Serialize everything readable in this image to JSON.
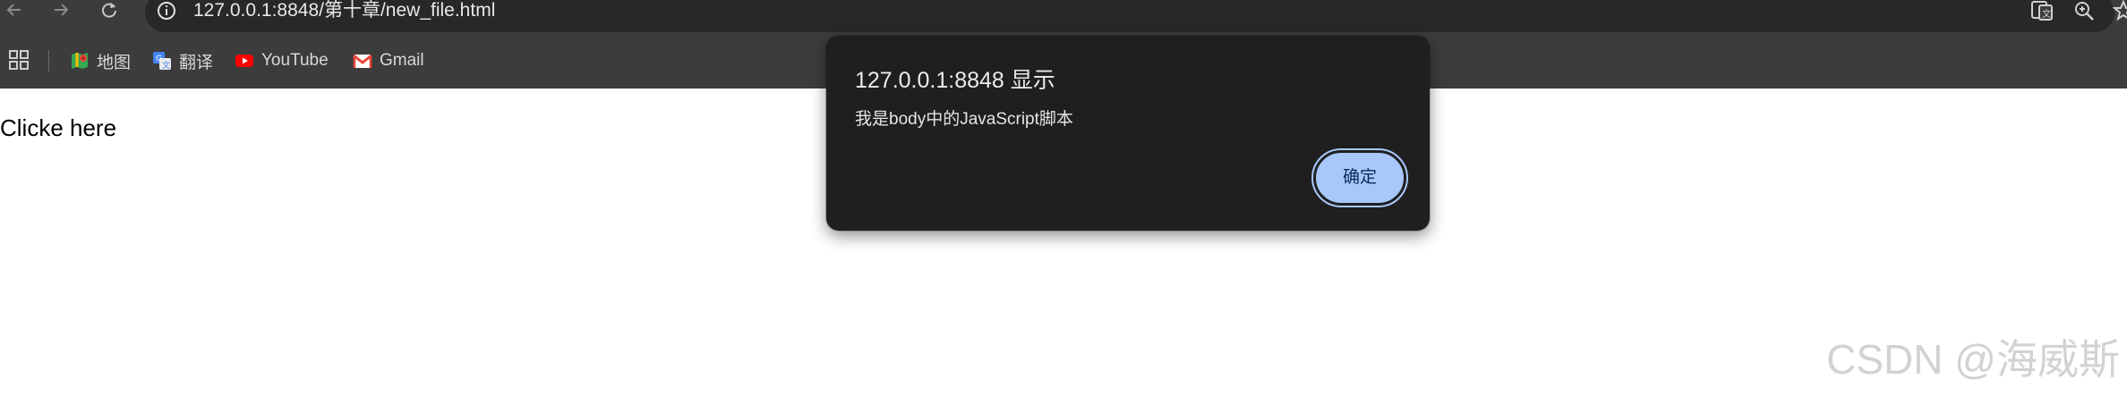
{
  "browser": {
    "url": "127.0.0.1:8848/第十章/new_file.html",
    "bookmarks": [
      {
        "label": "地图",
        "icon": "maps-icon"
      },
      {
        "label": "翻译",
        "icon": "translate-icon"
      },
      {
        "label": "YouTube",
        "icon": "youtube-icon"
      },
      {
        "label": "Gmail",
        "icon": "gmail-icon"
      }
    ]
  },
  "page": {
    "link_text": "Clicke here"
  },
  "dialog": {
    "title": "127.0.0.1:8848 显示",
    "message": "我是body中的JavaScript脚本",
    "ok_label": "确定"
  },
  "watermark": "CSDN @海威斯",
  "colors": {
    "chrome_bg": "#3c3c3c",
    "omnibox_bg": "#282828",
    "dialog_bg": "#1f1f1f",
    "ok_button": "#a8c7fa"
  }
}
